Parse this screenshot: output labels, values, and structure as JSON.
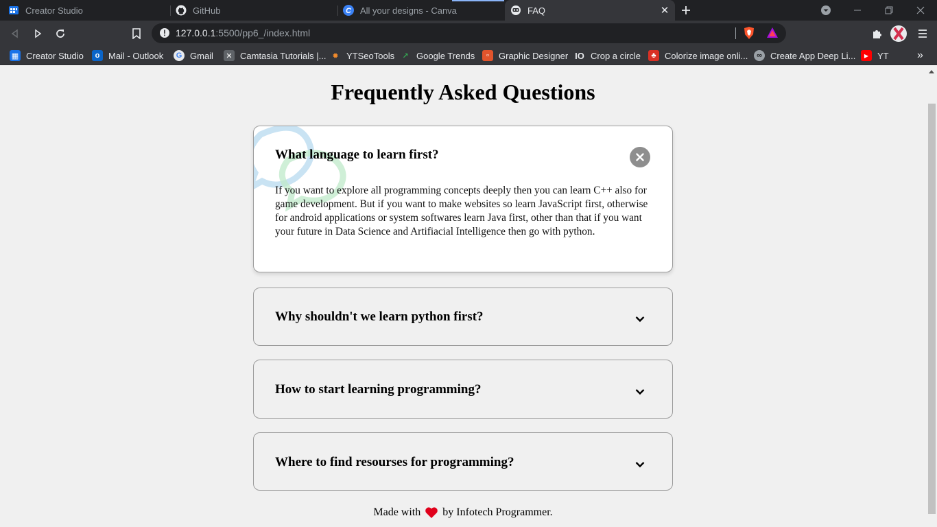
{
  "browser": {
    "tabs": [
      {
        "title": "Creator Studio"
      },
      {
        "title": "GitHub"
      },
      {
        "title": "All your designs - Canva"
      },
      {
        "title": "FAQ"
      }
    ],
    "url_host": "127.0.0.1",
    "url_rest": ":5500/pp6_/index.html",
    "bookmarks": [
      {
        "label": "Creator Studio"
      },
      {
        "label": "Mail - Outlook"
      },
      {
        "label": "Gmail"
      },
      {
        "label": "Camtasia Tutorials |..."
      },
      {
        "label": "YTSeoTools"
      },
      {
        "label": "Google Trends"
      },
      {
        "label": "Graphic Designer"
      },
      {
        "label": "Crop a circle"
      },
      {
        "label": "Colorize image onli..."
      },
      {
        "label": "Create App Deep Li..."
      },
      {
        "label": "YT"
      }
    ],
    "bookmarks_overflow": "»",
    "colors": {
      "tabbar": "#202124",
      "toolbar": "#35363a",
      "accent": "#8ab4f8"
    }
  },
  "page": {
    "title": "Frequently Asked Questions",
    "faqs": [
      {
        "question": "What language to learn first?",
        "answer": "If you want to explore all programming concepts deeply then you can learn C++ also for game development. But if you want to make websites so learn JavaScript first, otherwise for android applications or system softwares learn Java first, other than that if you want your future in Data Science and Artifiacial Intelligence then go with python.",
        "expanded": true
      },
      {
        "question": "Why shouldn't we learn python first?",
        "expanded": false
      },
      {
        "question": "How to start learning programming?",
        "expanded": false
      },
      {
        "question": "Where to find resourses for programming?",
        "expanded": false
      }
    ],
    "footer": {
      "before": "Made with",
      "after": "by Infotech Programmer."
    },
    "colors": {
      "background": "#f0f0f0",
      "card_active": "#ffffff",
      "border": "#9c9c9c",
      "heart": "#e0001b",
      "close_button": "#8e8e8e"
    }
  }
}
